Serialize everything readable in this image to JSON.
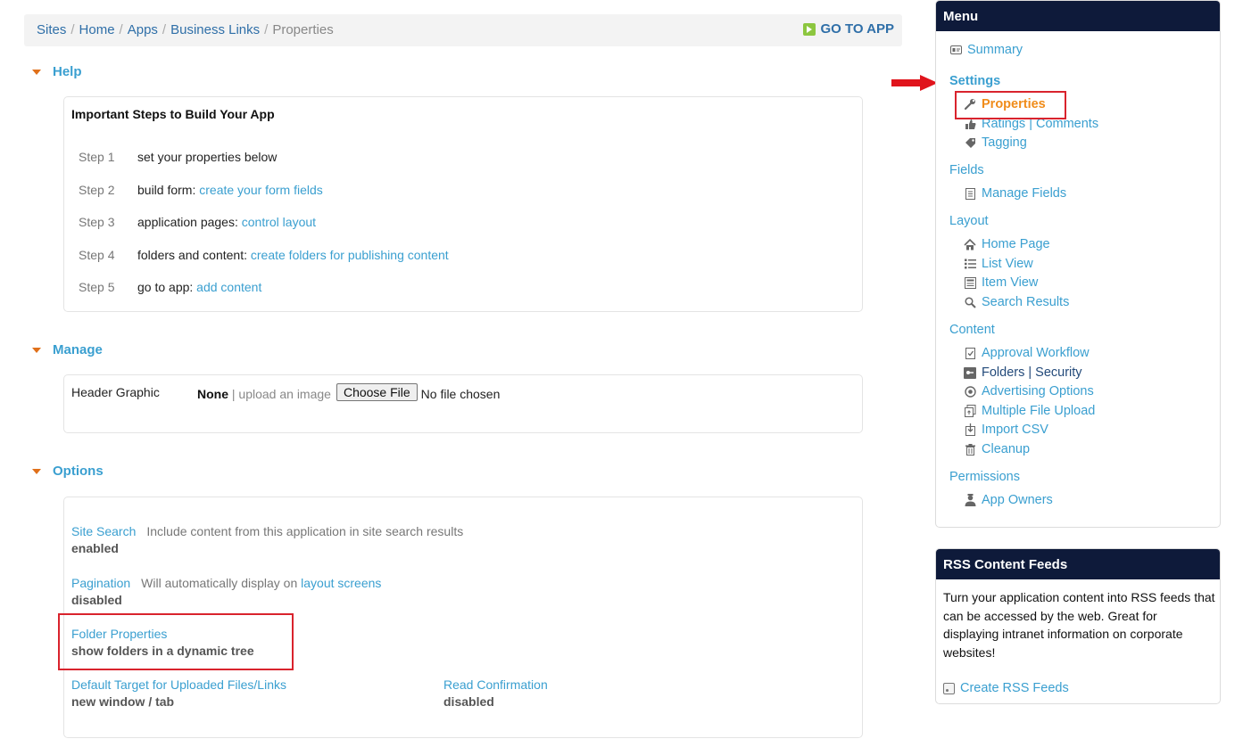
{
  "breadcrumb": {
    "items": [
      "Sites",
      "Home",
      "Apps",
      "Business Links"
    ],
    "current": "Properties",
    "separator": "/"
  },
  "goto_app": "GO TO APP",
  "help": {
    "section_title": "Help",
    "panel_title": "Important Steps to Build Your App",
    "steps": [
      {
        "num": "Step 1",
        "text": "set your properties below",
        "link": ""
      },
      {
        "num": "Step 2",
        "text": "build form:",
        "link": "create your form fields"
      },
      {
        "num": "Step 3",
        "text": "application pages:",
        "link": "control layout"
      },
      {
        "num": "Step 4",
        "text": "folders and content:",
        "link": "create folders for publishing content"
      },
      {
        "num": "Step 5",
        "text": "go to app:",
        "link": "add content"
      }
    ]
  },
  "manage": {
    "section_title": "Manage",
    "label": "Header Graphic",
    "value": "None",
    "separator": "|",
    "upload_text": "upload an image",
    "choose_button": "Choose File",
    "file_status": "No file chosen"
  },
  "options": {
    "section_title": "Options",
    "site_search": {
      "title": "Site Search",
      "desc": "Include content from this application in site search results",
      "value": "enabled"
    },
    "pagination": {
      "title": "Pagination",
      "desc": "Will automatically display on",
      "desc_link": "layout screens",
      "value": "disabled"
    },
    "folder_properties": {
      "title": "Folder Properties",
      "value": "show folders in a dynamic tree"
    },
    "default_target": {
      "title": "Default Target for Uploaded Files/Links",
      "value": "new window / tab"
    },
    "read_confirmation": {
      "title": "Read Confirmation",
      "value": "disabled"
    }
  },
  "menu": {
    "title": "Menu",
    "summary": "Summary",
    "settings": "Settings",
    "properties": "Properties",
    "ratings": "Ratings | Comments",
    "tagging": "Tagging",
    "fields": "Fields",
    "manage_fields": "Manage Fields",
    "layout": "Layout",
    "home_page": "Home Page",
    "list_view": "List View",
    "item_view": "Item View",
    "search_results": "Search Results",
    "content": "Content",
    "approval_workflow": "Approval Workflow",
    "folders_security": "Folders | Security",
    "advertising_options": "Advertising Options",
    "multiple_file_upload": "Multiple File Upload",
    "import_csv": "Import CSV",
    "cleanup": "Cleanup",
    "permissions": "Permissions",
    "app_owners": "App Owners"
  },
  "rss": {
    "title": "RSS Content Feeds",
    "text": "Turn your application content into RSS feeds that can be accessed by the web. Great for displaying intranet information on corporate websites!",
    "link": "Create RSS Feeds"
  },
  "colors": {
    "link": "#3a9fd0",
    "accent": "#e0701a",
    "highlight": "#d9232d",
    "header_bg": "#0e1a3a"
  }
}
